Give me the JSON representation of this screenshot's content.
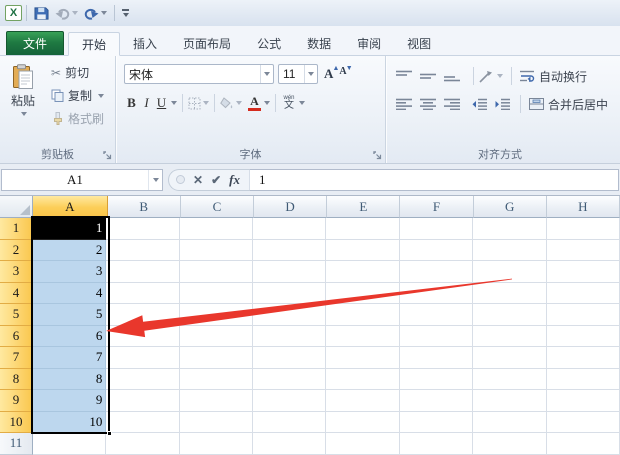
{
  "colors": {
    "file_tab_green": "#1F7A42",
    "selected_header_gold": "#FACB5F",
    "selection_blue": "#BDD7EE",
    "active_cell": "#000000",
    "arrow_red": "#E9372C",
    "font_color_red": "#D42B1E"
  },
  "icons": {
    "cut_glyph": "✂",
    "cancel_glyph": "✕",
    "enter_glyph": "✔",
    "fx_glyph": "fx"
  },
  "tabs": [
    {
      "label": "文件",
      "type": "file"
    },
    {
      "label": "开始",
      "active": true
    },
    {
      "label": "插入"
    },
    {
      "label": "页面布局"
    },
    {
      "label": "公式"
    },
    {
      "label": "数据"
    },
    {
      "label": "审阅"
    },
    {
      "label": "视图"
    }
  ],
  "ribbon": {
    "clipboard": {
      "group_label": "剪贴板",
      "paste_label": "粘贴",
      "cut_label": "剪切",
      "copy_label": "复制",
      "format_painter_label": "格式刷"
    },
    "font": {
      "group_label": "字体",
      "font_name": "宋体",
      "font_size": "11",
      "bold": "B",
      "italic": "I",
      "underline": "U",
      "grow_letter": "A",
      "shrink_letter": "A",
      "font_color_letter": "A",
      "phonetic_top": "wén",
      "phonetic_bottom": "文"
    },
    "alignment": {
      "group_label": "对齐方式",
      "wrap_text_label": "自动换行",
      "merge_center_label": "合并后居中"
    }
  },
  "formula_bar": {
    "name_box": "A1",
    "formula_value": "1"
  },
  "sheet": {
    "columns": [
      "A",
      "B",
      "C",
      "D",
      "E",
      "F",
      "G",
      "H"
    ],
    "rows": [
      "1",
      "2",
      "3",
      "4",
      "5",
      "6",
      "7",
      "8",
      "9",
      "10",
      "11"
    ],
    "column_a_values": [
      "1",
      "2",
      "3",
      "4",
      "5",
      "6",
      "7",
      "8",
      "9",
      "10"
    ],
    "selected_column": "A",
    "selected_rows": 10,
    "selected_range": "A1:A10"
  }
}
